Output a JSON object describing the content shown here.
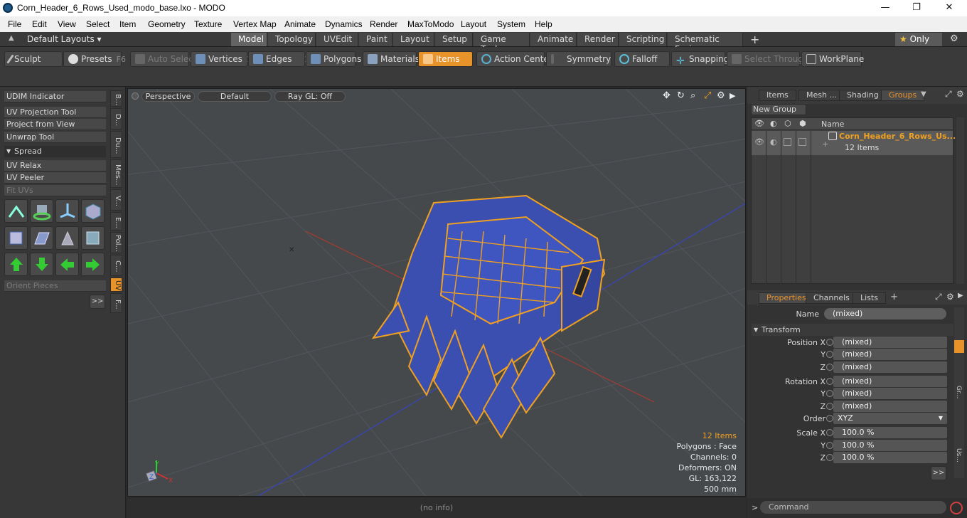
{
  "window": {
    "title": "Corn_Header_6_Rows_Used_modo_base.lxo - MODO",
    "minimize": "—",
    "maximize": "❐",
    "close": "✕"
  },
  "menu": [
    "File",
    "Edit",
    "View",
    "Select",
    "Item",
    "Geometry",
    "Texture",
    "Vertex Map",
    "Animate",
    "Dynamics",
    "Render",
    "MaxToModo",
    "Layout",
    "System",
    "Help"
  ],
  "layout_bar": {
    "layouts_label": "Default Layouts",
    "tabs": [
      "Model",
      "Topology",
      "UVEdit",
      "Paint",
      "Layout",
      "Setup",
      "Game Tools",
      "Animate",
      "Render",
      "Scripting",
      "Schematic Fusion"
    ],
    "active_tab": "Model",
    "add": "+",
    "only_label": "Only",
    "star": "★",
    "gear": "⚙"
  },
  "toolbar": {
    "sculpt": "Sculpt",
    "presets": "Presets",
    "presets_key": "F6",
    "auto_select": "Auto Select",
    "vertices": "Vertices",
    "vertices_num": "1",
    "edges": "Edges",
    "edges_num": "2",
    "polygons": "Polygons",
    "materials": "Materials",
    "items": "Items",
    "action_center": "Action Center",
    "symmetry": "Symmetry",
    "falloff": "Falloff",
    "snapping": "Snapping",
    "select_through": "Select Through",
    "workplane": "WorkPlane"
  },
  "left_panel": {
    "buttons": [
      "UDIM Indicator",
      "UV Projection Tool",
      "Project from View",
      "Unwrap Tool"
    ],
    "spread": "Spread",
    "buttons2": [
      "UV Relax",
      "UV Peeler",
      "Fit UVs"
    ],
    "orient": "Orient Pieces",
    "more": ">>",
    "vtabs": [
      "B...",
      "D...",
      "Du...",
      "Mes...",
      "V...",
      "E...",
      "Pol...",
      "C...",
      "UV",
      "F..."
    ]
  },
  "viewport": {
    "perspective": "Perspective",
    "default": "Default",
    "raygl": "Ray GL: Off",
    "stats": {
      "items": "12 Items",
      "polygons": "Polygons : Face",
      "channels": "Channels: 0",
      "deformers": "Deformers: ON",
      "gl": "GL: 163,122",
      "size": "500 mm"
    },
    "axes": {
      "y": "Y",
      "x": "X",
      "z": "Z"
    },
    "status": "(no info)"
  },
  "groups_panel": {
    "tabs": [
      "Items",
      "Mesh ...",
      "Shading",
      "Groups"
    ],
    "active": "Groups",
    "new_group": "New Group",
    "name_header": "Name",
    "group_name": "Corn_Header_6_Rows_Us...",
    "group_count": "12 Items"
  },
  "properties_panel": {
    "tabs": [
      "Properties",
      "Channels",
      "Lists"
    ],
    "active": "Properties",
    "add": "+",
    "name_label": "Name",
    "name_value": "(mixed)",
    "transform": "Transform",
    "position": {
      "label": "Position X",
      "y": "Y",
      "z": "Z",
      "vx": "(mixed)",
      "vy": "(mixed)",
      "vz": "(mixed)"
    },
    "rotation": {
      "label": "Rotation X",
      "y": "Y",
      "z": "Z",
      "vx": "(mixed)",
      "vy": "(mixed)",
      "vz": "(mixed)"
    },
    "order_label": "Order",
    "order_value": "XYZ",
    "scale": {
      "label": "Scale X",
      "y": "Y",
      "z": "Z",
      "vx": "100.0 %",
      "vy": "100.0 %",
      "vz": "100.0 %"
    },
    "more": ">>",
    "side_tabs": [
      "Gr...",
      "Us..."
    ],
    "command_prompt": ">",
    "command_placeholder": "Command"
  },
  "colors": {
    "accent": "#e8922a",
    "wire": "#f0a020",
    "model_fill": "#3a4fb0",
    "viewport_bg": "#46494c"
  }
}
